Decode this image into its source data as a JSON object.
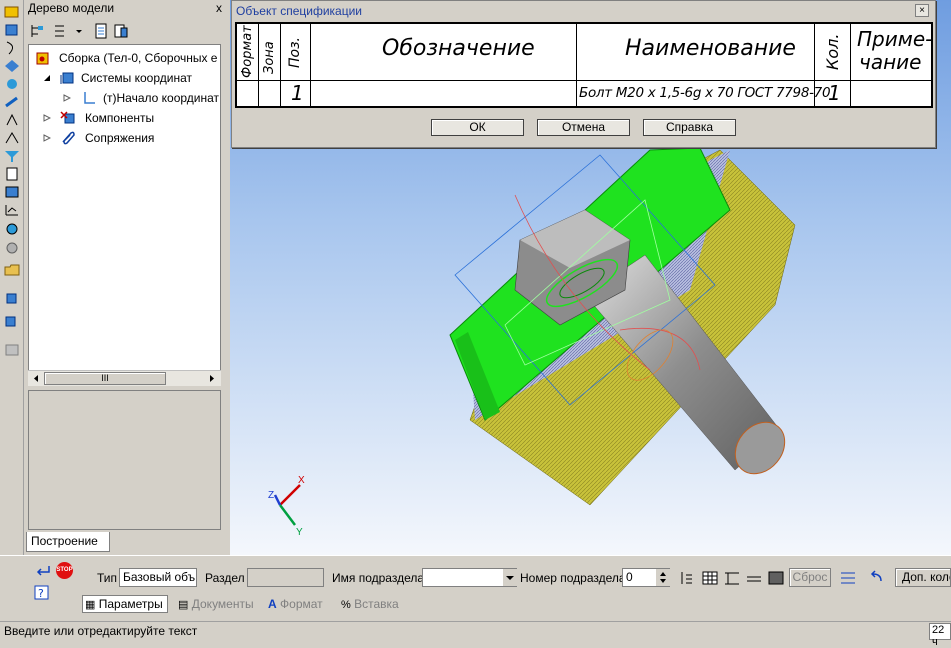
{
  "model_tree": {
    "title": "Дерево модели",
    "close": "x",
    "items": [
      {
        "label": "Сборка (Тел-0, Сборочных е"
      },
      {
        "label": "Системы координат"
      },
      {
        "label": "(т)Начало координат"
      },
      {
        "label": "Компоненты"
      },
      {
        "label": "Сопряжения"
      }
    ],
    "scroll_grip": "III",
    "tab_label": "Построение"
  },
  "dialog": {
    "title": "Объект спецификации",
    "close": "×",
    "headers": {
      "format": "Формат",
      "zone": "Зона",
      "pos": "Поз.",
      "designation": "Обозначение",
      "name": "Наименование",
      "qty": "Кол.",
      "note_line1": "Приме-",
      "note_line2": "чание"
    },
    "row": {
      "pos": "1",
      "name": "Болт М20 х 1,5-6g х 70 ГОСТ 7798-70",
      "qty": "1"
    },
    "buttons": {
      "ok": "ОК",
      "cancel": "Отмена",
      "help": "Справка"
    }
  },
  "axes": {
    "x": "X",
    "y": "Y",
    "z": "Z"
  },
  "propbar": {
    "type_label": "Тип",
    "type_value": "Базовый объ",
    "section_label": "Раздел",
    "section_value": "",
    "subsection_name_label": "Имя подраздела",
    "subsection_name_value": "",
    "subsection_num_label": "Номер подраздела",
    "subsection_num_value": "0",
    "reset_label": "Сброс",
    "more_label": "Доп. коло",
    "stop_label": "STOP",
    "tabs": [
      "Параметры",
      "Документы",
      "Формат",
      "Вставка"
    ]
  },
  "status": {
    "text": "Введите или отредактируйте текст",
    "right": "22 ч"
  },
  "colors": {
    "plate_green": "#1fe21f",
    "body_yellow": "#c8c23a",
    "bolt_grey": "#8e8e8e",
    "viewport_top": "#6f9de0"
  }
}
